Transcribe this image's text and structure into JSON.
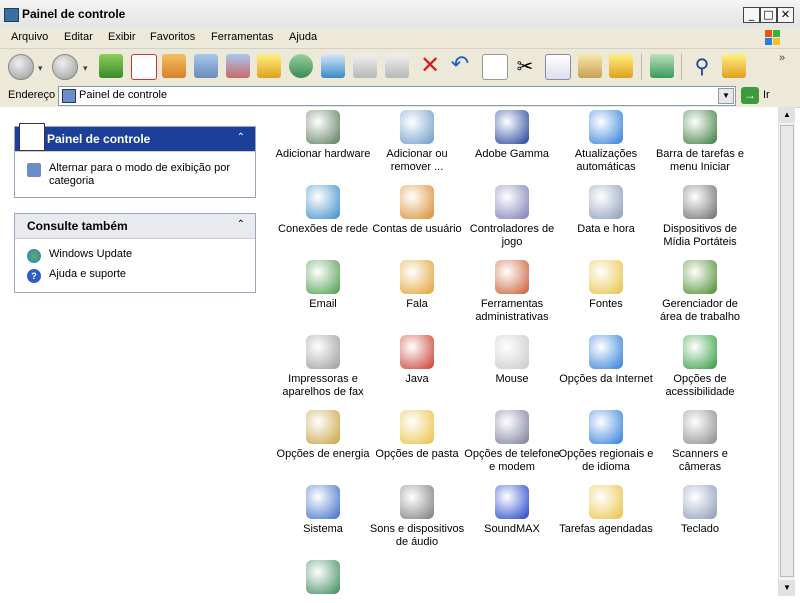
{
  "window": {
    "title": "Painel de controle",
    "min": "_",
    "max": "□",
    "close": "✕"
  },
  "menu": [
    "Arquivo",
    "Editar",
    "Exibir",
    "Favoritos",
    "Ferramentas",
    "Ajuda"
  ],
  "address": {
    "label": "Endereço",
    "value": "Painel de controle",
    "go_label": "Ir"
  },
  "left_panel": {
    "control_panel": {
      "title": "Painel de controle",
      "switch_link": "Alternar para o modo de exibição por categoria"
    },
    "see_also": {
      "title": "Consulte também",
      "links": [
        "Windows Update",
        "Ajuda e suporte"
      ]
    }
  },
  "items": [
    {
      "label": "Adicionar hardware",
      "icon": "hardware-icon",
      "color": "#5a7a5a"
    },
    {
      "label": "Adicionar ou remover ...",
      "icon": "add-remove-programs-icon",
      "color": "#6a9ac8"
    },
    {
      "label": "Adobe Gamma",
      "icon": "monitor-icon",
      "color": "#1c3f99"
    },
    {
      "label": "Atualizações automáticas",
      "icon": "windows-update-icon",
      "color": "#2c7cd8"
    },
    {
      "label": "Barra de tarefas e menu Iniciar",
      "icon": "taskbar-icon",
      "color": "#3a7a3a"
    },
    {
      "label": "Conexões de rede",
      "icon": "network-icon",
      "color": "#3a8ac8"
    },
    {
      "label": "Contas de usuário",
      "icon": "users-icon",
      "color": "#d88a2c"
    },
    {
      "label": "Controladores de jogo",
      "icon": "gamepad-icon",
      "color": "#7a7ab8"
    },
    {
      "label": "Data e hora",
      "icon": "calendar-clock-icon",
      "color": "#8a9ab8"
    },
    {
      "label": "Dispositivos de Mídia Portáteis",
      "icon": "portable-media-icon",
      "color": "#6a6a6a"
    },
    {
      "label": "Email",
      "icon": "email-icon",
      "color": "#4a9a4a"
    },
    {
      "label": "Fala",
      "icon": "speech-icon",
      "color": "#e0a030"
    },
    {
      "label": "Ferramentas administrativas",
      "icon": "admin-tools-icon",
      "color": "#c85a2c"
    },
    {
      "label": "Fontes",
      "icon": "fonts-folder-icon",
      "color": "#e8c040"
    },
    {
      "label": "Gerenciador de área de trabalho",
      "icon": "nvidia-icon",
      "color": "#4a8a2a"
    },
    {
      "label": "Impressoras e aparelhos de fax",
      "icon": "printer-icon",
      "color": "#9a9a9a"
    },
    {
      "label": "Java",
      "icon": "java-icon",
      "color": "#c83a2c"
    },
    {
      "label": "Mouse",
      "icon": "mouse-icon",
      "color": "#c8c8c8"
    },
    {
      "label": "Opções da Internet",
      "icon": "internet-options-icon",
      "color": "#2c7cd8"
    },
    {
      "label": "Opções de acessibilidade",
      "icon": "accessibility-icon",
      "color": "#2c9a3a"
    },
    {
      "label": "Opções de energia",
      "icon": "power-icon",
      "color": "#c8a040"
    },
    {
      "label": "Opções de pasta",
      "icon": "folder-options-icon",
      "color": "#e8c040"
    },
    {
      "label": "Opções de telefone e modem",
      "icon": "phone-modem-icon",
      "color": "#7a7a9a"
    },
    {
      "label": "Opções regionais e de idioma",
      "icon": "globe-icon",
      "color": "#2c7cd8"
    },
    {
      "label": "Scanners e câmeras",
      "icon": "scanner-icon",
      "color": "#8a8a8a"
    },
    {
      "label": "Sistema",
      "icon": "system-icon",
      "color": "#3a6ac8"
    },
    {
      "label": "Sons e dispositivos de áudio",
      "icon": "speaker-icon",
      "color": "#7a7a7a"
    },
    {
      "label": "SoundMAX",
      "icon": "soundmax-icon",
      "color": "#1c3fc8"
    },
    {
      "label": "Tarefas agendadas",
      "icon": "scheduled-tasks-icon",
      "color": "#e8c040"
    },
    {
      "label": "Teclado",
      "icon": "keyboard-icon",
      "color": "#8a9ab8"
    },
    {
      "label": "",
      "icon": "display-icon",
      "color": "#3a8a5a"
    }
  ]
}
